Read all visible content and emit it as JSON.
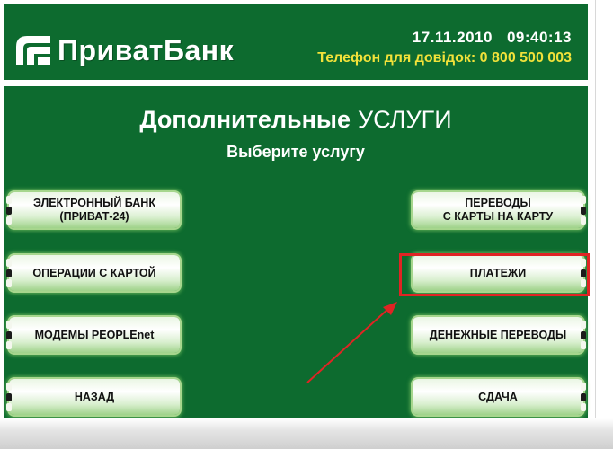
{
  "header": {
    "brand_name": "ПриватБанк",
    "date": "17.11.2010",
    "time": "09:40:13",
    "phone_text": "Телефон для довідок: 0 800 500 003"
  },
  "main": {
    "title_bold": "Дополнительные",
    "title_rest": "УСЛУГИ",
    "subtitle": "Выберите услугу"
  },
  "buttons": {
    "electronic_bank": "ЭЛЕКТРОННЫЙ БАНК\n(ПРИВАТ-24)",
    "card_operations": "ОПЕРАЦИИ С КАРТОЙ",
    "modems": "МОДЕМЫ PEOPLEnet",
    "back": "НАЗАД",
    "card_transfers": "ПЕРЕВОДЫ\nС КАРТЫ НА КАРТУ",
    "payments": "ПЛАТЕЖИ",
    "money_transfers": "ДЕНЕЖНЫЕ ПЕРЕВОДЫ",
    "change": "СДАЧА"
  },
  "colors": {
    "brand_green": "#0d6b2f",
    "phone_yellow": "#f2e23a",
    "highlight_red": "#e02424"
  },
  "icons": {
    "logo": "privatbank-logo-icon",
    "annotation": "red-arrow-icon"
  }
}
